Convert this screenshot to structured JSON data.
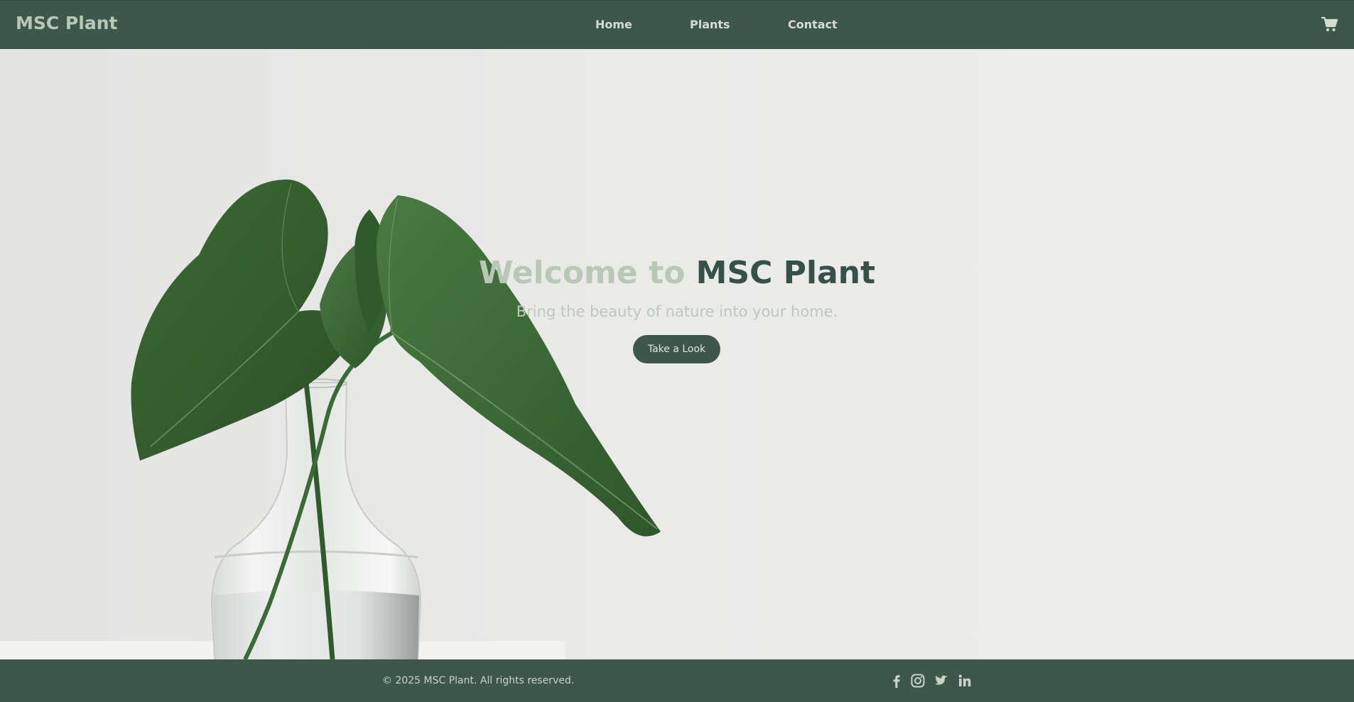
{
  "header": {
    "logo": "MSC Plant",
    "nav": {
      "home": "Home",
      "plants": "Plants",
      "contact": "Contact"
    },
    "cart_icon": "shopping-cart-icon"
  },
  "hero": {
    "title_lead": "Welcome to",
    "title_brand": "MSC Plant",
    "subtitle": "Bring the beauty of nature into your home.",
    "cta_label": "Take a Look"
  },
  "footer": {
    "copyright": "© 2025 MSC Plant. All rights reserved.",
    "social_icons": [
      "facebook-icon",
      "instagram-icon",
      "twitter-icon",
      "linkedin-icon"
    ]
  },
  "colors": {
    "primary": "#3d574d",
    "accent_light": "#b8c8b5",
    "brand_text": "#35514a",
    "background": "#ebebea"
  }
}
